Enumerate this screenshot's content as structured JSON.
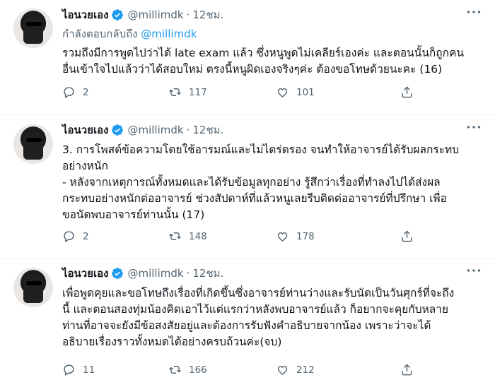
{
  "tweets": [
    {
      "name": "ไอนวยเอง",
      "handle": "@millimdk",
      "time": "12ชม.",
      "replying_prefix": "กำลังตอบกลับถึง",
      "replying_mention": "@millimdk",
      "text": "รวมถึงมีการพูดไปว่าได้ late exam แล้ว ซึ่งหนูพูดไม่เคลียร์เองค่ะ และตอนนั้นก็ถูกคน\nอื่นเข้าใจไปแล้วว่าได้สอบใหม่ ตรงนี้หนูผิดเองจริงๆค่ะ ต้องขอโทษด้วยนะคะ (16)",
      "replies": "2",
      "retweets": "117",
      "likes": "101"
    },
    {
      "name": "ไอนวยเอง",
      "handle": "@millimdk",
      "time": "12ชม.",
      "text": "3. การโพสต์ข้อความโดยใช้อารมณ์และไม่ไตร่ตรอง จนทำให้อาจารย์ได้รับผลกระทบ\nอย่างหนัก\n- หลังจากเหตุการณ์ทั้งหมดและได้รับข้อมูลทุกอย่าง รู้สึกว่าเรื่องที่ทำลงไปได้ส่งผล\nกระทบอย่างหนักต่ออาจารย์ ช่วงสัปดาห์ที่แล้วหนูเลยรีบติดต่ออาจารย์ที่ปรึกษา เพื่อ\nขอนัดพบอาจารย์ท่านนั้น (17)",
      "replies": "2",
      "retweets": "148",
      "likes": "178"
    },
    {
      "name": "ไอนวยเอง",
      "handle": "@millimdk",
      "time": "12ชม.",
      "text": "เพื่อพูดคุยและขอโทษถึงเรื่องที่เกิดขึ้นซึ่งอาจารย์ท่านว่างและรับนัดเป็นวันศุกร์ที่จะถึง\nนี้ และตอนสองทุ่มน้องคิดเอาไว้แต่แรกว่าหลังพบอาจารย์แล้ว ก็อยากจะคุยกับหลาย\nท่านที่อาจจะยังมีข้อสงสัยอยู่และต้องการรับฟังคำอธิบายจากน้อง เพราะว่าจะได้\nอธิบายเรื่องราวทั้งหมดได้อย่างครบถ้วนค่ะ(จบ)",
      "replies": "11",
      "retweets": "166",
      "likes": "212"
    }
  ],
  "colors": {
    "accent": "#1d9bf0",
    "secondary_text": "#536471",
    "divider": "#eff3f4"
  },
  "icons": [
    "reply-icon",
    "retweet-icon",
    "like-icon",
    "share-icon",
    "verified-badge-icon",
    "more-icon"
  ]
}
